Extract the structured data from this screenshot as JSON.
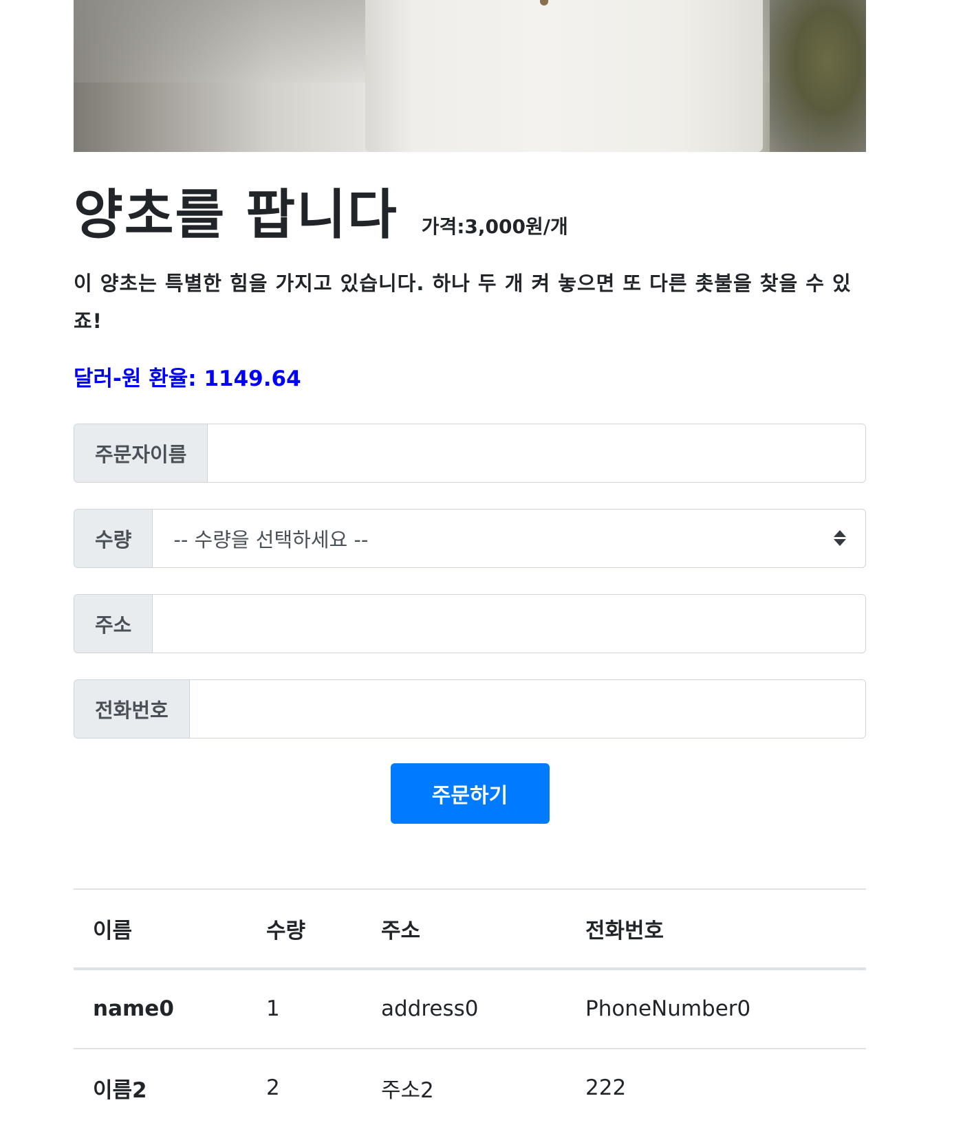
{
  "product": {
    "title": "양초를 팝니다",
    "price": "가격:3,000원/개",
    "description": "이 양초는 특별한 힘을 가지고 있습니다. 하나 두 개 켜 놓으면 또 다른 촛불을 찾을 수 있죠!",
    "exchange_rate": "달러-원 환율: 1149.64"
  },
  "form": {
    "name_label": "주문자이름",
    "name_value": "",
    "quantity_label": "수량",
    "quantity_selected": "-- 수량을 선택하세요 --",
    "address_label": "주소",
    "address_value": "",
    "phone_label": "전화번호",
    "phone_value": "",
    "submit_label": "주문하기"
  },
  "orders": {
    "headers": [
      "이름",
      "수량",
      "주소",
      "전화번호"
    ],
    "rows": [
      [
        "name0",
        "1",
        "address0",
        "PhoneNumber0"
      ],
      [
        "이름2",
        "2",
        "주소2",
        "222"
      ]
    ]
  },
  "colors": {
    "accent": "#007bff",
    "rate_text": "#0000ff"
  }
}
